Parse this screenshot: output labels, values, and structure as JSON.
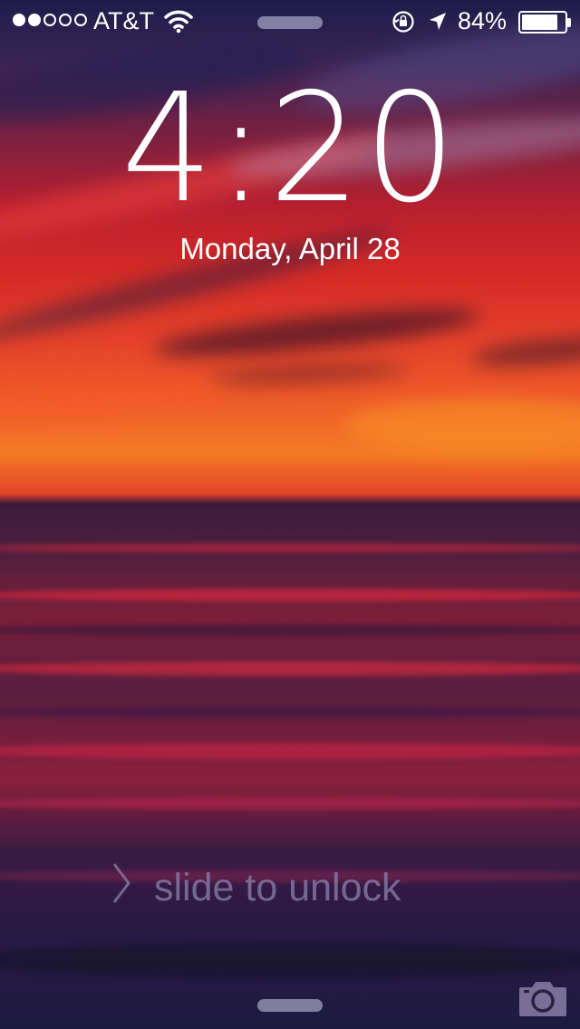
{
  "status_bar": {
    "signal_strength": 2,
    "signal_max": 5,
    "carrier": "AT&T",
    "battery_percent_text": "84%",
    "battery_level": 0.84,
    "icons": [
      "wifi-icon",
      "rotation-lock-icon",
      "location-arrow-icon",
      "battery-icon"
    ]
  },
  "lock_screen": {
    "time": "4:20",
    "date": "Monday, April 28",
    "unlock_text": "slide to unlock",
    "icons": [
      "chevron-right-icon",
      "camera-icon"
    ]
  },
  "colors": {
    "text": "#ffffff",
    "unlock_text": "#8c82af",
    "grabber": "#b4b4d2"
  }
}
